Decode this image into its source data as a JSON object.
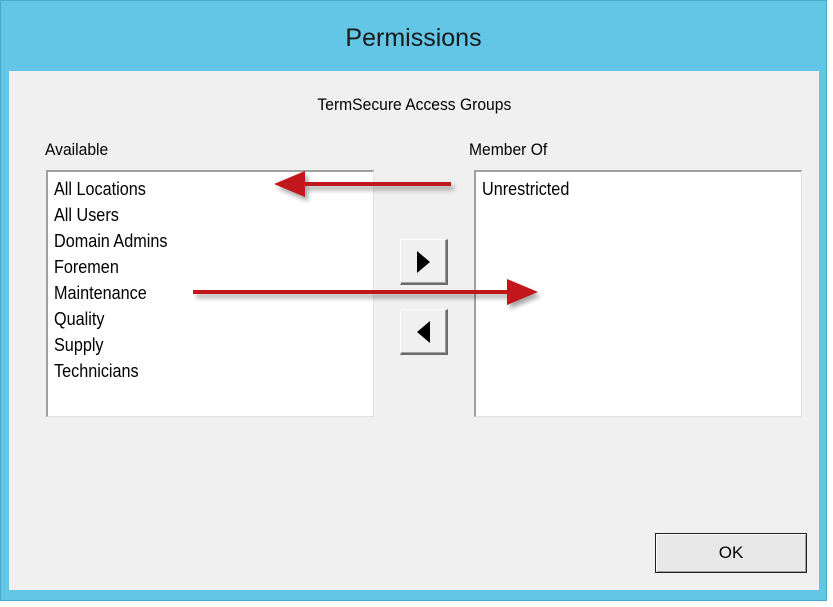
{
  "window": {
    "title": "Permissions"
  },
  "dialog": {
    "groups_label": "TermSecure Access Groups",
    "available": {
      "label": "Available",
      "items": [
        "All Locations",
        "All Users",
        "Domain Admins",
        "Foremen",
        "Maintenance",
        "Quality",
        "Supply",
        "Technicians"
      ]
    },
    "member_of": {
      "label": "Member Of",
      "items": [
        "Unrestricted"
      ]
    },
    "add_button_icon": "triangle-right-icon",
    "remove_button_icon": "triangle-left-icon",
    "ok_label": "OK"
  },
  "annotations": {
    "arrow_color": "#c0141c"
  }
}
